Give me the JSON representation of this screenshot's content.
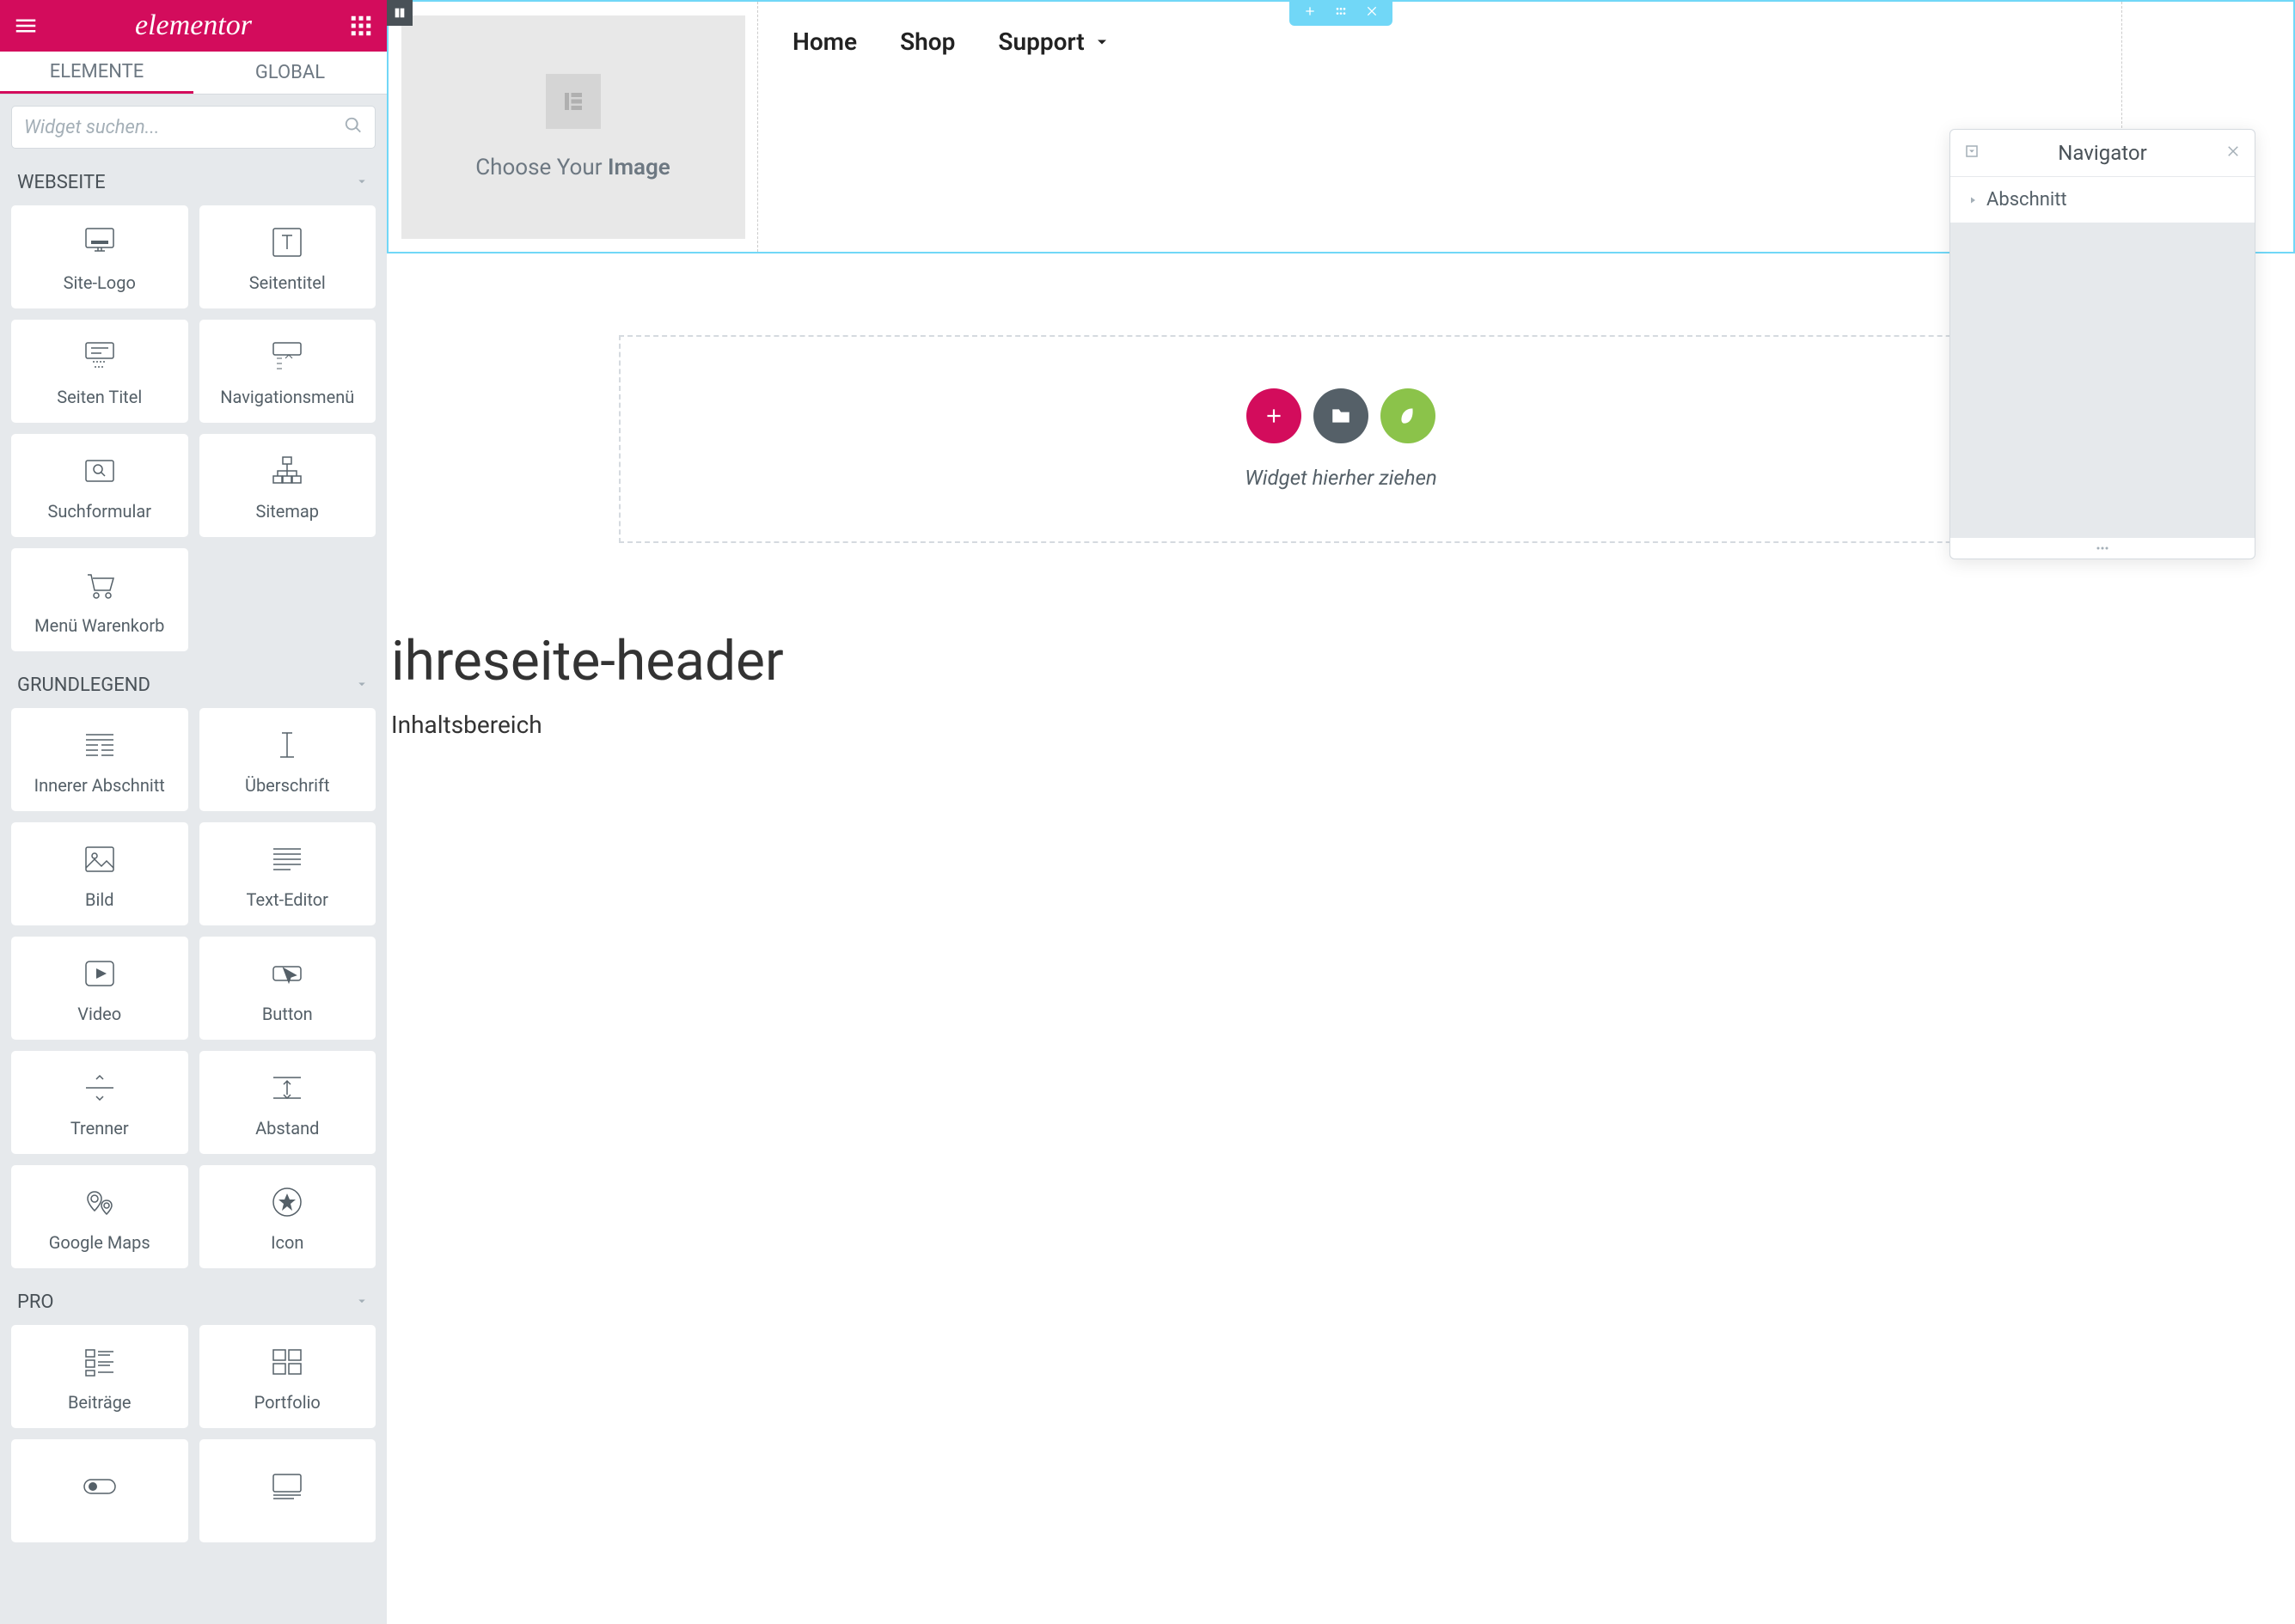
{
  "header": {
    "logo": "elementor"
  },
  "tabs": {
    "elements": "ELEMENTE",
    "global": "GLOBAL"
  },
  "search": {
    "placeholder": "Widget suchen..."
  },
  "categories": {
    "webseite": "WEBSEITE",
    "grundlegend": "GRUNDLEGEND",
    "pro": "PRO"
  },
  "widgets": {
    "webseite": [
      {
        "label": "Site-Logo",
        "icon": "logo"
      },
      {
        "label": "Seitentitel",
        "icon": "title"
      },
      {
        "label": "Seiten Titel",
        "icon": "pagetitle"
      },
      {
        "label": "Navigationsmenü",
        "icon": "navmenu"
      },
      {
        "label": "Suchformular",
        "icon": "searchform"
      },
      {
        "label": "Sitemap",
        "icon": "sitemap"
      },
      {
        "label": "Menü Warenkorb",
        "icon": "cart"
      }
    ],
    "grundlegend": [
      {
        "label": "Innerer Abschnitt",
        "icon": "columns"
      },
      {
        "label": "Überschrift",
        "icon": "heading"
      },
      {
        "label": "Bild",
        "icon": "image"
      },
      {
        "label": "Text-Editor",
        "icon": "text"
      },
      {
        "label": "Video",
        "icon": "video"
      },
      {
        "label": "Button",
        "icon": "button"
      },
      {
        "label": "Trenner",
        "icon": "divider"
      },
      {
        "label": "Abstand",
        "icon": "spacer"
      },
      {
        "label": "Google Maps",
        "icon": "map"
      },
      {
        "label": "Icon",
        "icon": "star"
      }
    ],
    "pro": [
      {
        "label": "Beiträge",
        "icon": "posts"
      },
      {
        "label": "Portfolio",
        "icon": "portfolio"
      },
      {
        "label": "",
        "icon": "extra1"
      },
      {
        "label": "",
        "icon": "extra2"
      }
    ]
  },
  "canvas": {
    "image_placeholder_prefix": "Choose Your ",
    "image_placeholder_bold": "Image",
    "nav": [
      "Home",
      "Shop",
      "Support"
    ],
    "dropzone_text": "Widget hierher ziehen",
    "page_title": "ihreseite-header",
    "content_area": "Inhaltsbereich"
  },
  "navigator": {
    "title": "Navigator",
    "item": "Abschnitt"
  }
}
